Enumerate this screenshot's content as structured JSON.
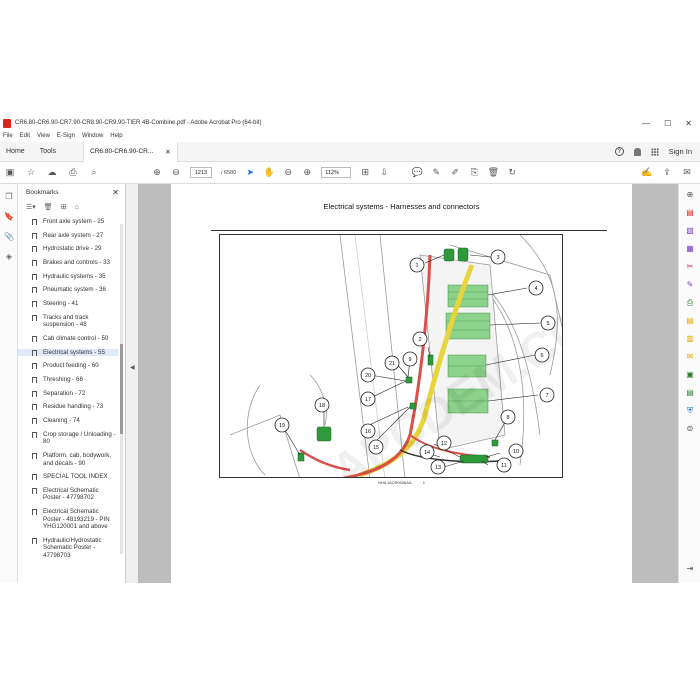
{
  "window": {
    "title": "CR6.80-CR6.90-CR7.90-CR8.90-CR9.90-TIER 4B-Combine.pdf - Adobe Acrobat Pro (64-bit)",
    "controls": [
      "—",
      "☐",
      "✕"
    ]
  },
  "menu": [
    "File",
    "Edit",
    "View",
    "E-Sign",
    "Window",
    "Help"
  ],
  "tabs": {
    "home": "Home",
    "tools": "Tools",
    "document": "CR6.80-CR6.90-CR...",
    "help": "?",
    "signin": "Sign In"
  },
  "toolbar": {
    "page_current": "1213",
    "page_total": "/ 6580",
    "zoom": "112%"
  },
  "bookmarks": {
    "header": "Bookmarks",
    "items": [
      {
        "label": "Front axle system - 25"
      },
      {
        "label": "Rear axle system - 27"
      },
      {
        "label": "Hydrostatic drive - 29"
      },
      {
        "label": "Brakes and controls - 33"
      },
      {
        "label": "Hydraulic systems - 35"
      },
      {
        "label": "Pneumatic system - 36"
      },
      {
        "label": "Steering - 41"
      },
      {
        "label": "Tracks and track suspension - 48"
      },
      {
        "label": "Cab climate control - 50"
      },
      {
        "label": "Electrical systems - 55",
        "selected": true
      },
      {
        "label": "Product feeding - 60"
      },
      {
        "label": "Threshing - 66"
      },
      {
        "label": "Separation - 72"
      },
      {
        "label": "Residue handling - 73"
      },
      {
        "label": "Cleaning - 74"
      },
      {
        "label": "Crop storage / Unloading - 80"
      },
      {
        "label": "Platform, cab, bodywork, and decals - 90"
      },
      {
        "label": "SPECIAL TOOL INDEX"
      },
      {
        "label": "Electrical Schematic Poster - 47798702"
      },
      {
        "label": "Electrical Schematic Poster - 48193219 - PIN YHG120001 and above"
      },
      {
        "label": "Hydraulic/Hydrostatic Schematic Poster - 47798703"
      }
    ]
  },
  "document": {
    "page_title": "Electrical systems - Harnesses and connectors",
    "figure_code": "NHIL16CR0026AA",
    "figure_number": "1",
    "callouts": [
      "1",
      "2",
      "3",
      "4",
      "5",
      "6",
      "7",
      "8",
      "9",
      "10",
      "11",
      "12",
      "13",
      "14",
      "15",
      "16",
      "17",
      "18",
      "19",
      "20",
      "21"
    ],
    "watermark": "APCDEM.COM"
  },
  "colors": {
    "acrobat_red": "#d9261c",
    "selection": "#dfe9f7",
    "connector_green": "#2e9a3c",
    "harness_yellow": "#e8d53c",
    "harness_red": "#d8504a"
  }
}
